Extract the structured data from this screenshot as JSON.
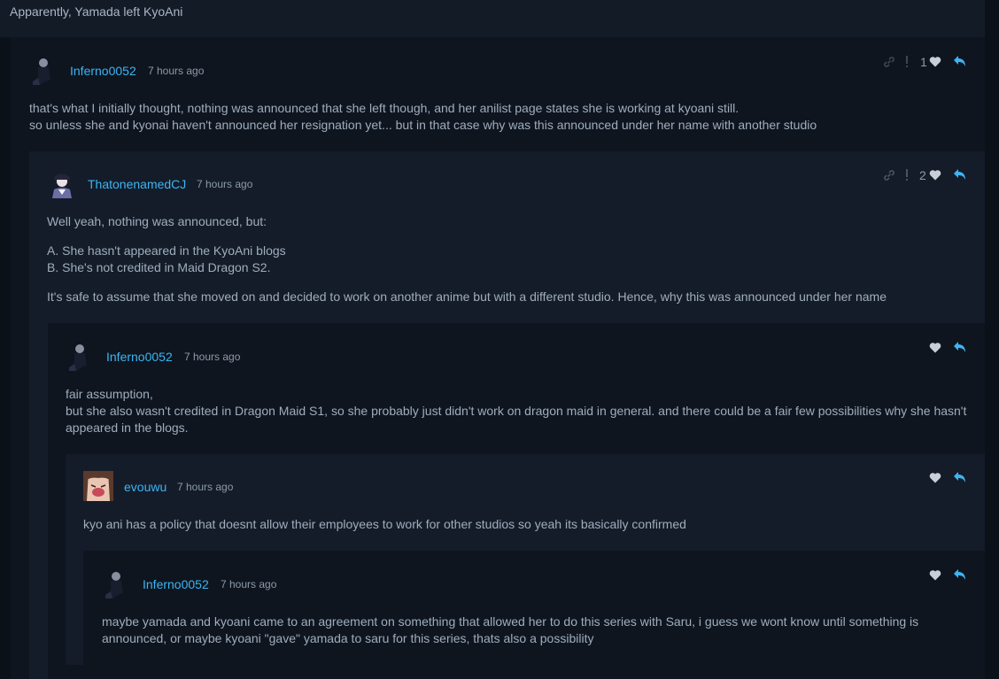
{
  "thread_title": "Apparently, Yamada left KyoAni",
  "colors": {
    "username": "#3db4f2",
    "reply_icon": "#3db4f2",
    "text": "#9fadbd"
  },
  "comments": [
    {
      "username": "Inferno0052",
      "time": "7 hours ago",
      "likes": "1",
      "lines": [
        "that's what I initially thought, nothing was announced that she left though, and her anilist page states she is working at kyoani still.",
        "so unless she and kyonai haven't announced her resignation yet... but in that case why was this announced under her name with another studio"
      ]
    },
    {
      "username": "ThatonenamedCJ",
      "time": "7 hours ago",
      "likes": "2",
      "lines": [
        "Well yeah, nothing was announced, but:",
        "A. She hasn't appeared in the KyoAni blogs",
        "B. She's not credited in Maid Dragon S2.",
        "It's safe to assume that she moved on and decided to work on another anime but with a different studio. Hence, why this was announced under her name"
      ]
    },
    {
      "username": "Inferno0052",
      "time": "7 hours ago",
      "lines": [
        "fair assumption,",
        "but she also wasn't credited in Dragon Maid S1, so she probably just didn't work on dragon maid in general. and there could be a fair few possibilities why she hasn't appeared in the blogs."
      ]
    },
    {
      "username": "evouwu",
      "time": "7 hours ago",
      "lines": [
        "kyo ani has a policy that doesnt allow their employees to work for other studios so yeah its basically confirmed"
      ]
    },
    {
      "username": "Inferno0052",
      "time": "7 hours ago",
      "lines": [
        "maybe yamada and kyoani came to an agreement on something that allowed her to do this series with Saru, i guess we wont know until something is announced, or maybe kyoani \"gave\" yamada to saru for this series, thats also a possibility"
      ]
    }
  ]
}
